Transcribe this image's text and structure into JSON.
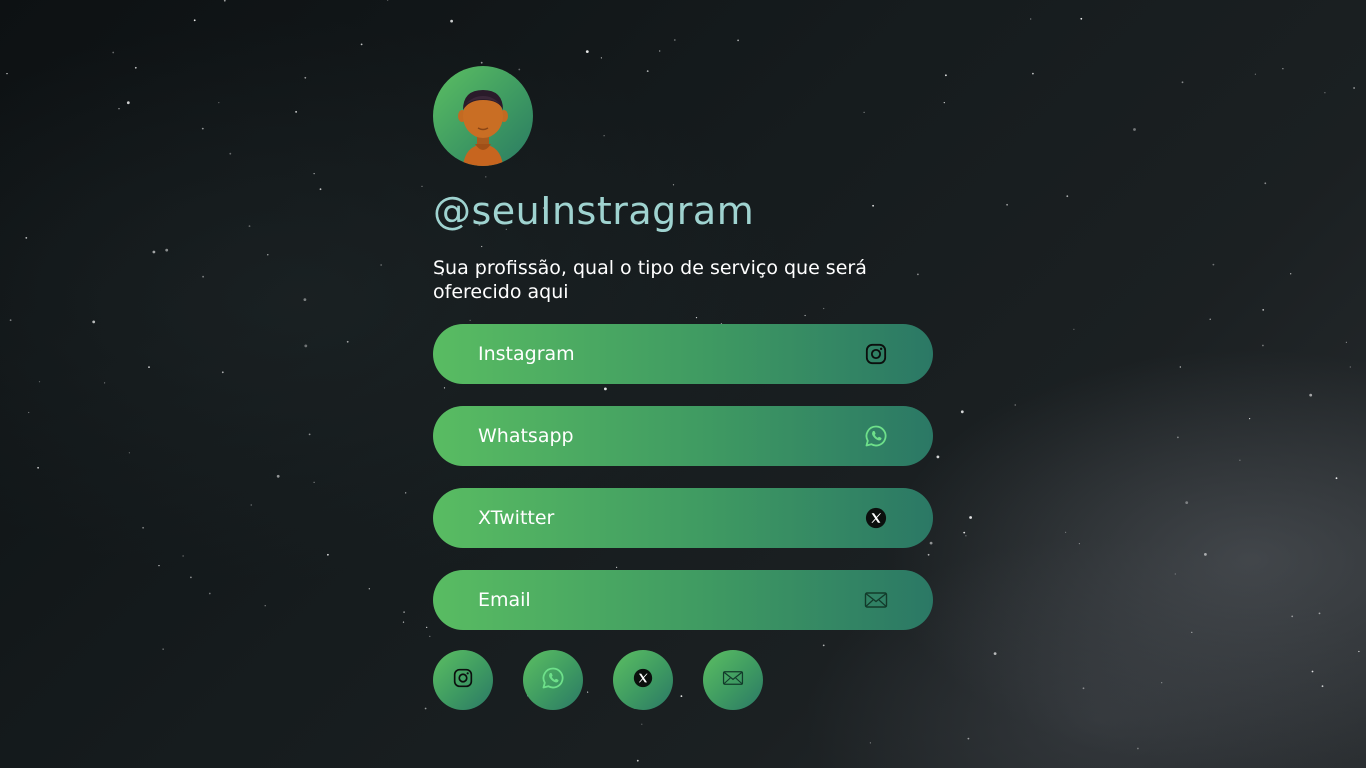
{
  "profile": {
    "handle": "@seuInstragram",
    "bio": "Sua profissão, qual o tipo de serviço que será oferecido aqui"
  },
  "links": [
    {
      "label": "Instagram",
      "icon": "instagram-icon"
    },
    {
      "label": "Whatsapp",
      "icon": "whatsapp-icon"
    },
    {
      "label": "XTwitter",
      "icon": "x-twitter-icon"
    },
    {
      "label": "Email",
      "icon": "email-icon"
    }
  ],
  "social_icons": [
    "instagram-icon",
    "whatsapp-icon",
    "x-twitter-icon",
    "email-icon"
  ],
  "colors": {
    "accent_start": "#59bc62",
    "accent_end": "#2b7865",
    "handle_text": "#9fd3d0",
    "whatsapp_green": "#5fd37a"
  }
}
